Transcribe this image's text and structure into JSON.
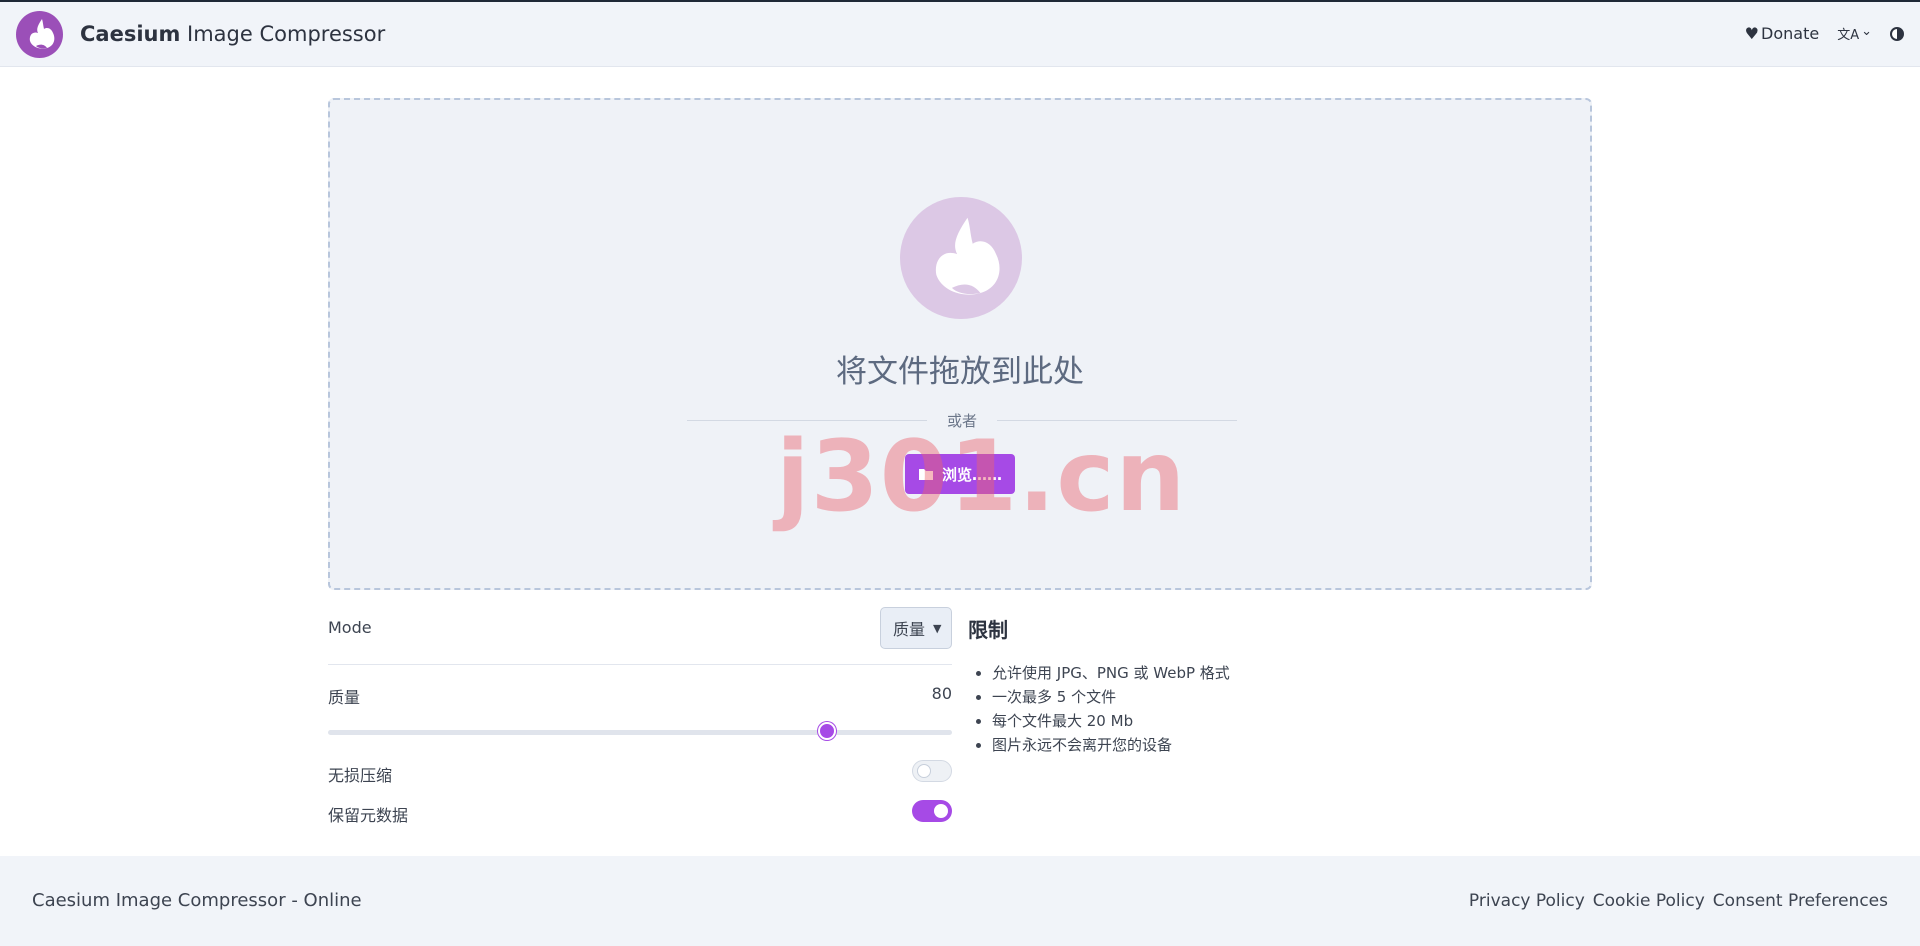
{
  "header": {
    "brand_bold": "Caesium",
    "brand_rest": " Image Compressor",
    "donate_icon": "♥",
    "donate_label": "Donate",
    "language_icon": "文A",
    "chevron": "⌄"
  },
  "dropzone": {
    "title": "将文件拖放到此处",
    "or_text": "或者",
    "browse_label": "浏览……"
  },
  "watermark": "j301.cn",
  "settings": {
    "mode_label": "Mode",
    "mode_value": "质量",
    "quality_label": "质量",
    "quality_value": "80",
    "quality_fraction": 0.8,
    "lossless_label": "无损压缩",
    "lossless_on": false,
    "keep_metadata_label": "保留元数据",
    "keep_metadata_on": true
  },
  "limits": {
    "title": "限制",
    "items": [
      "允许使用 JPG、PNG 或 WebP 格式",
      "一次最多 5 个文件",
      "每个文件最大 20 Mb",
      "图片永远不会离开您的设备"
    ]
  },
  "footer": {
    "left": "Caesium Image Compressor - Online",
    "links": [
      "Privacy Policy",
      "Cookie Policy",
      "Consent Preferences"
    ]
  },
  "colors": {
    "accent": "#a64ae6",
    "logo": "#9b4fb8",
    "background_soft": "#f1f4f9"
  }
}
